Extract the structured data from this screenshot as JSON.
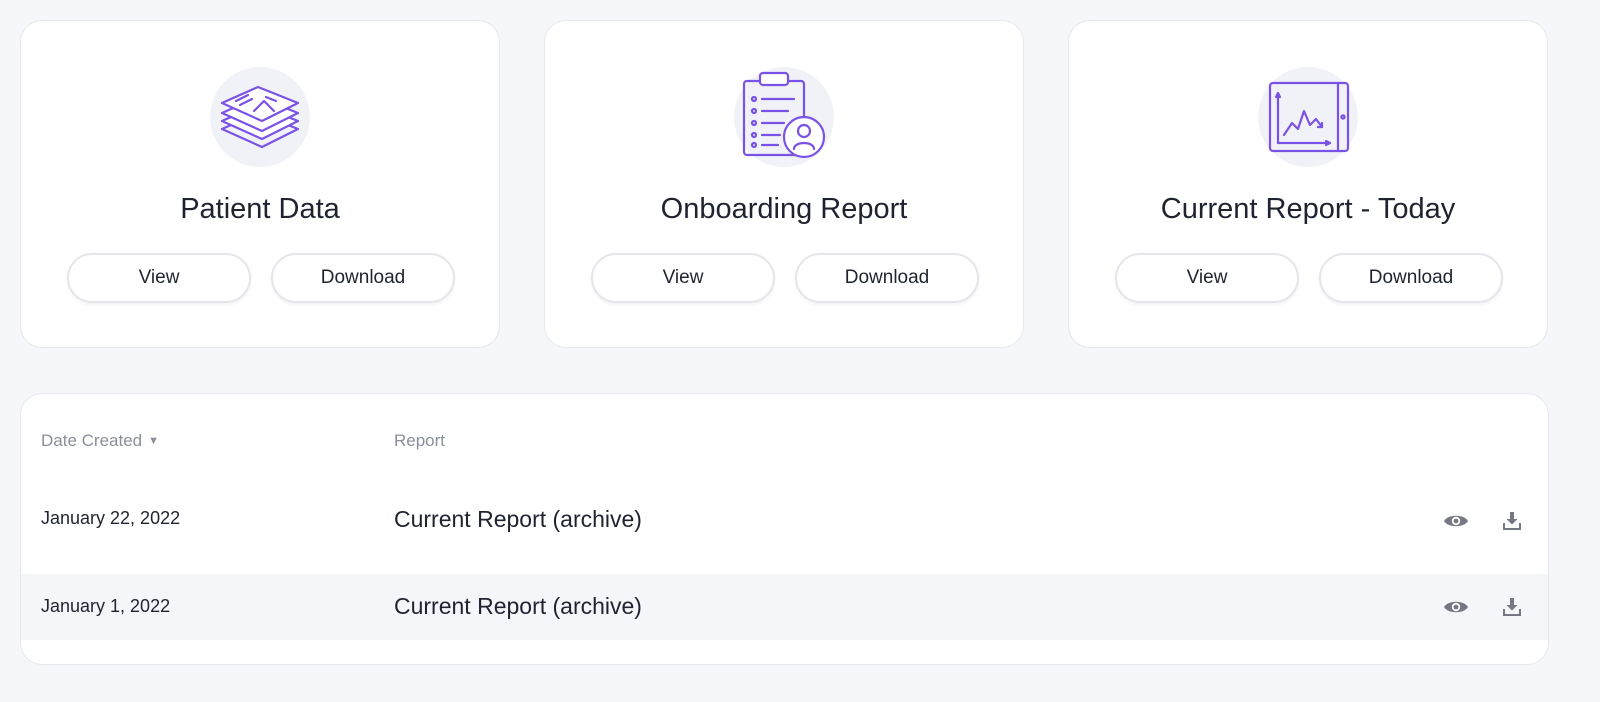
{
  "colors": {
    "accent": "#7b52e6",
    "icon_bg": "#f1f2f8",
    "muted": "#8b8f9c",
    "action_icon": "#757883"
  },
  "cards": [
    {
      "title": "Patient Data",
      "icon": "stacked-documents-icon",
      "view_label": "View",
      "download_label": "Download"
    },
    {
      "title": "Onboarding Report",
      "icon": "clipboard-user-icon",
      "view_label": "View",
      "download_label": "Download"
    },
    {
      "title": "Current Report - Today",
      "icon": "line-chart-tablet-icon",
      "view_label": "View",
      "download_label": "Download"
    }
  ],
  "table": {
    "columns": {
      "date": "Date Created",
      "date_sort_icon": "caret-down-icon",
      "report": "Report"
    },
    "rows": [
      {
        "date": "January 22, 2022",
        "report": "Current Report (archive)",
        "actions": [
          "eye-icon",
          "download-icon"
        ]
      },
      {
        "date": "January 1, 2022",
        "report": "Current Report (archive)",
        "actions": [
          "eye-icon",
          "download-icon"
        ]
      }
    ]
  }
}
